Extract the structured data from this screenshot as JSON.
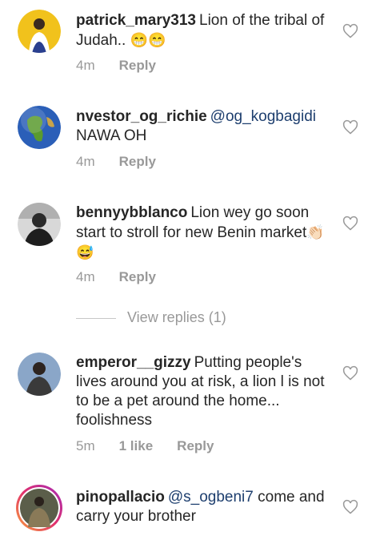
{
  "comments": [
    {
      "username": "patrick_mary313",
      "mention": "",
      "text": "Lion of the tribal of Judah.. ",
      "emoji": "😁😁",
      "time": "4m",
      "likes": "",
      "reply": "Reply"
    },
    {
      "username": "nvestor_og_richie",
      "mention": "@og_kogbagidi",
      "text": "NAWA OH",
      "emoji": "",
      "time": "4m",
      "likes": "",
      "reply": "Reply"
    },
    {
      "username": "bennyybblanco",
      "mention": "",
      "text": "Lion wey go soon start to stroll for new Benin market",
      "emoji": "👏🏻😅",
      "time": "4m",
      "likes": "",
      "reply": "Reply"
    },
    {
      "username": "emperor__gizzy",
      "mention": "",
      "text": "Putting people's lives around you at risk, a lion l is not to be a pet around the home... foolishness",
      "emoji": "",
      "time": "5m",
      "likes": "1 like",
      "reply": "Reply"
    },
    {
      "username": "pinopallacio",
      "mention": "@s_ogbeni7",
      "text": "come and carry your brother",
      "emoji": "",
      "time": "",
      "likes": "",
      "reply": ""
    }
  ],
  "view_replies": "View replies (1)",
  "icons": {
    "like": "heart-outline-icon"
  },
  "colors": {
    "mention": "#1d3e6e",
    "meta": "#999999",
    "text": "#262626"
  }
}
